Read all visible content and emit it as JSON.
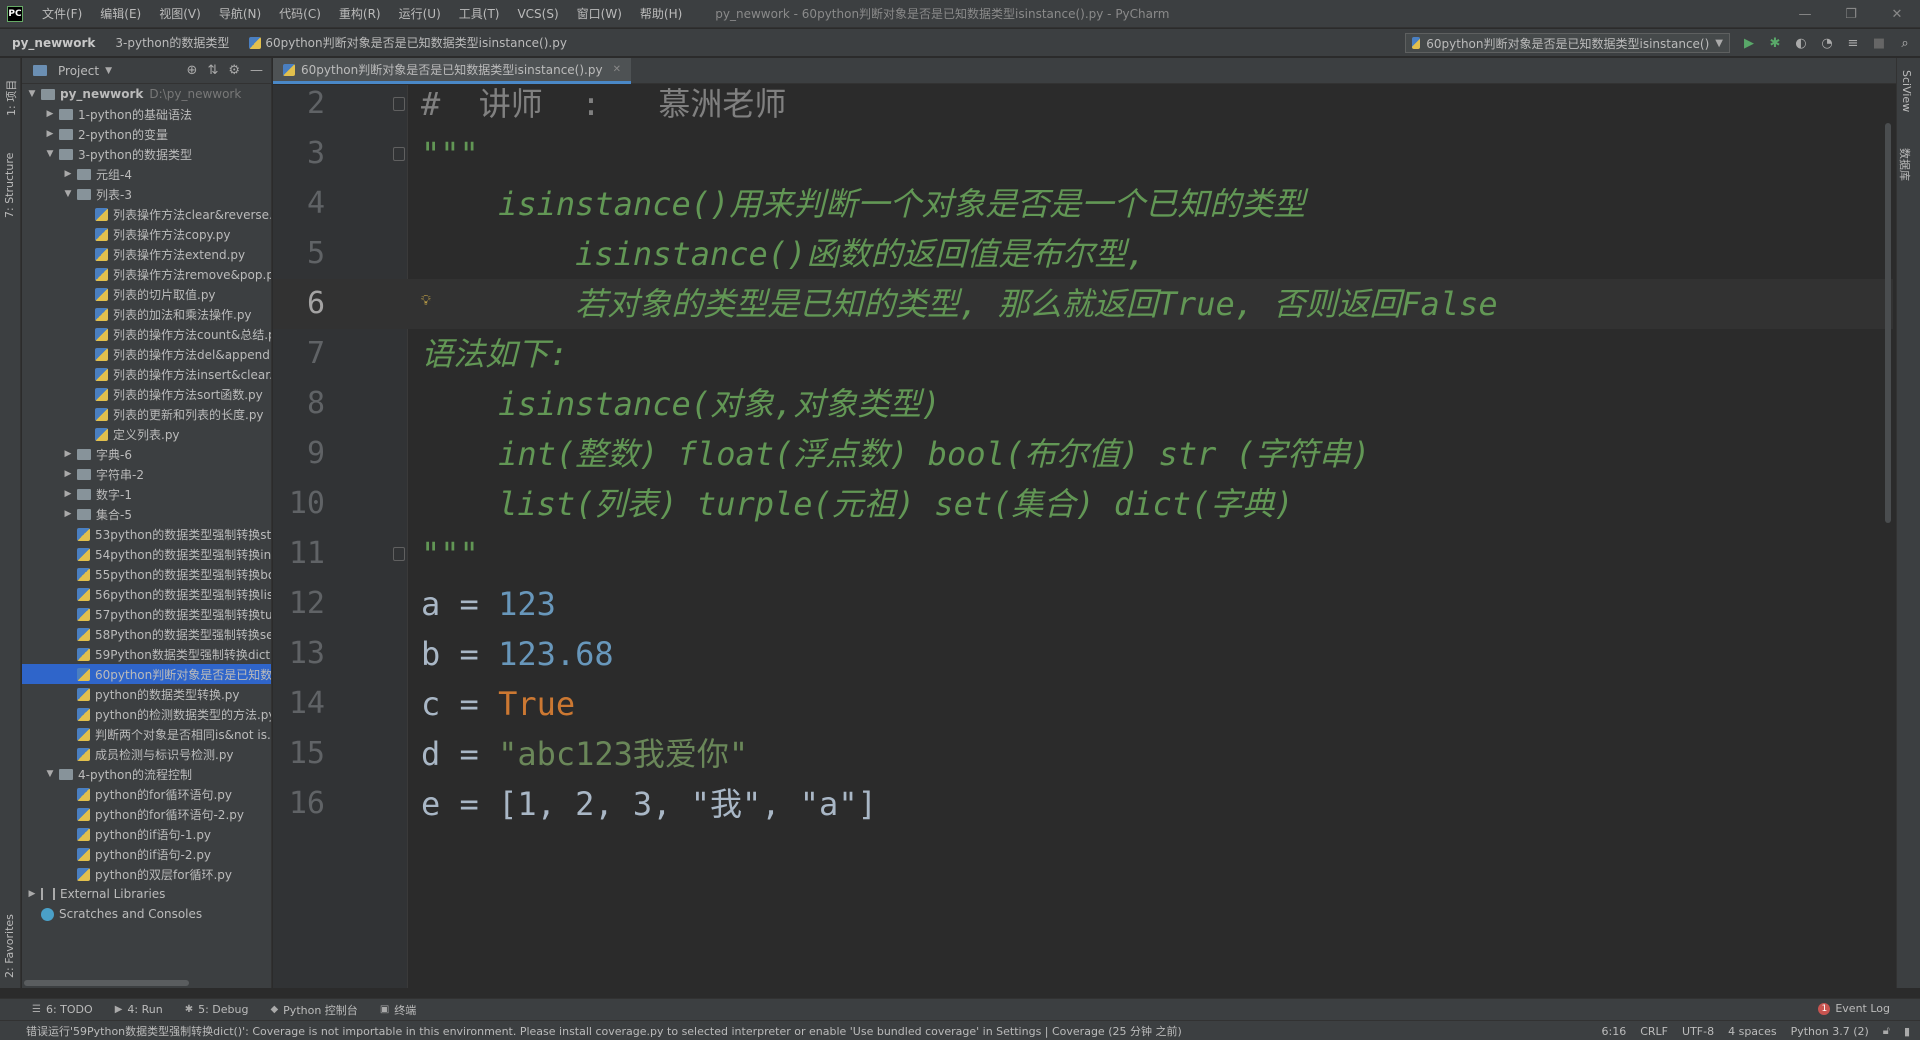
{
  "titlebar": {
    "logo": "PC",
    "menus": [
      "文件(F)",
      "编辑(E)",
      "视图(V)",
      "导航(N)",
      "代码(C)",
      "重构(R)",
      "运行(U)",
      "工具(T)",
      "VCS(S)",
      "窗口(W)",
      "帮助(H)"
    ],
    "window_title": "py_newwork - 60python判断对象是否是已知数据类型isinstance().py - PyCharm"
  },
  "navbar": {
    "crumbs": [
      "py_newwork",
      "3-python的数据类型",
      "60python判断对象是否是已知数据类型isinstance().py"
    ],
    "run_config": "60python判断对象是否是已知数据类型isinstance()"
  },
  "left_strip": {
    "project_label": "1: 项目",
    "structure_label": "7: Structure",
    "favorites_label": "2: Favorites"
  },
  "project_panel": {
    "title": "Project",
    "tree": [
      {
        "depth": 0,
        "type": "folder",
        "open": true,
        "label": "py_newwork",
        "path": "D:\\py_newwork",
        "bold": true
      },
      {
        "depth": 1,
        "type": "folder",
        "open": false,
        "label": "1-python的基础语法"
      },
      {
        "depth": 1,
        "type": "folder",
        "open": false,
        "label": "2-python的变量"
      },
      {
        "depth": 1,
        "type": "folder",
        "open": true,
        "label": "3-python的数据类型"
      },
      {
        "depth": 2,
        "type": "folder",
        "open": false,
        "label": "元组-4"
      },
      {
        "depth": 2,
        "type": "folder",
        "open": true,
        "label": "列表-3"
      },
      {
        "depth": 3,
        "type": "file",
        "label": "列表操作方法clear&reverse."
      },
      {
        "depth": 3,
        "type": "file",
        "label": "列表操作方法copy.py"
      },
      {
        "depth": 3,
        "type": "file",
        "label": "列表操作方法extend.py"
      },
      {
        "depth": 3,
        "type": "file",
        "label": "列表操作方法remove&pop.p"
      },
      {
        "depth": 3,
        "type": "file",
        "label": "列表的切片取值.py"
      },
      {
        "depth": 3,
        "type": "file",
        "label": "列表的加法和乘法操作.py"
      },
      {
        "depth": 3,
        "type": "file",
        "label": "列表的操作方法count&总结.p"
      },
      {
        "depth": 3,
        "type": "file",
        "label": "列表的操作方法del&append"
      },
      {
        "depth": 3,
        "type": "file",
        "label": "列表的操作方法insert&clear."
      },
      {
        "depth": 3,
        "type": "file",
        "label": "列表的操作方法sort函数.py"
      },
      {
        "depth": 3,
        "type": "file",
        "label": "列表的更新和列表的长度.py"
      },
      {
        "depth": 3,
        "type": "file",
        "label": "定义列表.py"
      },
      {
        "depth": 2,
        "type": "folder",
        "open": false,
        "label": "字典-6"
      },
      {
        "depth": 2,
        "type": "folder",
        "open": false,
        "label": "字符串-2"
      },
      {
        "depth": 2,
        "type": "folder",
        "open": false,
        "label": "数字-1"
      },
      {
        "depth": 2,
        "type": "folder",
        "open": false,
        "label": "集合-5"
      },
      {
        "depth": 2,
        "type": "file",
        "label": "53python的数据类型强制转换str"
      },
      {
        "depth": 2,
        "type": "file",
        "label": "54python的数据类型强制转换int"
      },
      {
        "depth": 2,
        "type": "file",
        "label": "55python的数据类型强制转换bo"
      },
      {
        "depth": 2,
        "type": "file",
        "label": "56python的数据类型强制转换lis"
      },
      {
        "depth": 2,
        "type": "file",
        "label": "57python的数据类型强制转换tu"
      },
      {
        "depth": 2,
        "type": "file",
        "label": "58Python的数据类型强制转换se"
      },
      {
        "depth": 2,
        "type": "file",
        "label": "59Python数据类型强制转换dict("
      },
      {
        "depth": 2,
        "type": "file",
        "label": "60python判断对象是否是已知数",
        "selected": true
      },
      {
        "depth": 2,
        "type": "file",
        "label": "python的数据类型转换.py"
      },
      {
        "depth": 2,
        "type": "file",
        "label": "python的检测数据类型的方法.py"
      },
      {
        "depth": 2,
        "type": "file",
        "label": "判断两个对象是否相同is&not is."
      },
      {
        "depth": 2,
        "type": "file",
        "label": "成员检测与标识号检测.py"
      },
      {
        "depth": 1,
        "type": "folder",
        "open": true,
        "label": "4-python的流程控制"
      },
      {
        "depth": 2,
        "type": "file",
        "label": "python的for循环语句.py"
      },
      {
        "depth": 2,
        "type": "file",
        "label": "python的for循环语句-2.py"
      },
      {
        "depth": 2,
        "type": "file",
        "label": "python的if语句-1.py"
      },
      {
        "depth": 2,
        "type": "file",
        "label": "python的if语句-2.py"
      },
      {
        "depth": 2,
        "type": "file",
        "label": "python的双层for循环.py"
      },
      {
        "depth": 0,
        "type": "lib",
        "open": false,
        "label": "External Libraries"
      },
      {
        "depth": 0,
        "type": "scratch",
        "label": "Scratches and Consoles"
      }
    ]
  },
  "editor": {
    "tab_label": "60python判断对象是否是已知数据类型isinstance().py",
    "current_line": 6,
    "lines": [
      {
        "n": "2",
        "fold": true,
        "tokens": [
          {
            "c": "cm",
            "t": "#  讲师  :   慕洲老师"
          }
        ]
      },
      {
        "n": "3",
        "fold": true,
        "tokens": [
          {
            "c": "doc",
            "t": "\"\"\""
          }
        ]
      },
      {
        "n": "4",
        "tokens": [
          {
            "c": "doc",
            "t": "    isinstance()用来判断一个对象是否是一个已知的类型"
          }
        ]
      },
      {
        "n": "5",
        "tokens": [
          {
            "c": "doc",
            "t": "        isinstance()函数的返回值是布尔型,"
          }
        ]
      },
      {
        "n": "6",
        "bulb": true,
        "tokens": [
          {
            "c": "doc",
            "t": "        若对象的类型是已知的类型, 那么就返回True, 否则返回False"
          }
        ]
      },
      {
        "n": "7",
        "tokens": [
          {
            "c": "doc",
            "t": "语法如下:"
          }
        ]
      },
      {
        "n": "8",
        "tokens": [
          {
            "c": "doc",
            "t": "    isinstance(对象,对象类型)"
          }
        ]
      },
      {
        "n": "9",
        "tokens": [
          {
            "c": "doc",
            "t": "    int(整数) float(浮点数) bool(布尔值) str (字符串)"
          }
        ]
      },
      {
        "n": "10",
        "tokens": [
          {
            "c": "doc",
            "t": "    list(列表) turple(元祖) set(集合) dict(字典)"
          }
        ]
      },
      {
        "n": "11",
        "fold": true,
        "tokens": [
          {
            "c": "doc",
            "t": "\"\"\""
          }
        ]
      },
      {
        "n": "12",
        "tokens": [
          {
            "c": "id",
            "t": "a = "
          },
          {
            "c": "num",
            "t": "123"
          }
        ]
      },
      {
        "n": "13",
        "tokens": [
          {
            "c": "id",
            "t": "b = "
          },
          {
            "c": "num",
            "t": "123.68"
          }
        ]
      },
      {
        "n": "14",
        "tokens": [
          {
            "c": "id",
            "t": "c = "
          },
          {
            "c": "kw",
            "t": "True"
          }
        ]
      },
      {
        "n": "15",
        "tokens": [
          {
            "c": "id",
            "t": "d = "
          },
          {
            "c": "str",
            "t": "\"abc123我爱你\""
          }
        ]
      },
      {
        "n": "16",
        "tokens": [
          {
            "c": "id",
            "t": "e = "
          },
          {
            "c": "id",
            "t": "[1, 2, 3, \"我\", \"a\"]"
          }
        ]
      }
    ]
  },
  "right_strip": {
    "sciview": "SciView",
    "database": "数据库"
  },
  "bottom_tools": [
    {
      "icon": "list-icon",
      "glyph": "☰",
      "label": "6: TODO"
    },
    {
      "icon": "run-icon",
      "glyph": "▶",
      "label": "4: Run"
    },
    {
      "icon": "debug-icon",
      "glyph": "✱",
      "label": "5: Debug"
    },
    {
      "icon": "python-console-icon",
      "glyph": "◆",
      "label": "Python 控制台"
    },
    {
      "icon": "terminal-icon",
      "glyph": "▣",
      "label": "终端"
    }
  ],
  "event_log": {
    "count": "1",
    "label": "Event Log"
  },
  "status": {
    "message": "错误运行'59Python数据类型强制转换dict()': Coverage is not importable in this environment. Please install coverage.py to selected interpreter or enable 'Use bundled coverage' in Settings | Coverage (25 分钟 之前)",
    "position": "6:16",
    "line_sep": "CRLF",
    "encoding": "UTF-8",
    "indent": "4 spaces",
    "interpreter": "Python 3.7 (2)"
  },
  "colors": {
    "accent": "#4a88c7",
    "selection": "#2f65ca",
    "doc_green": "#629755",
    "number_blue": "#6897bb",
    "keyword_orange": "#cc7832"
  }
}
